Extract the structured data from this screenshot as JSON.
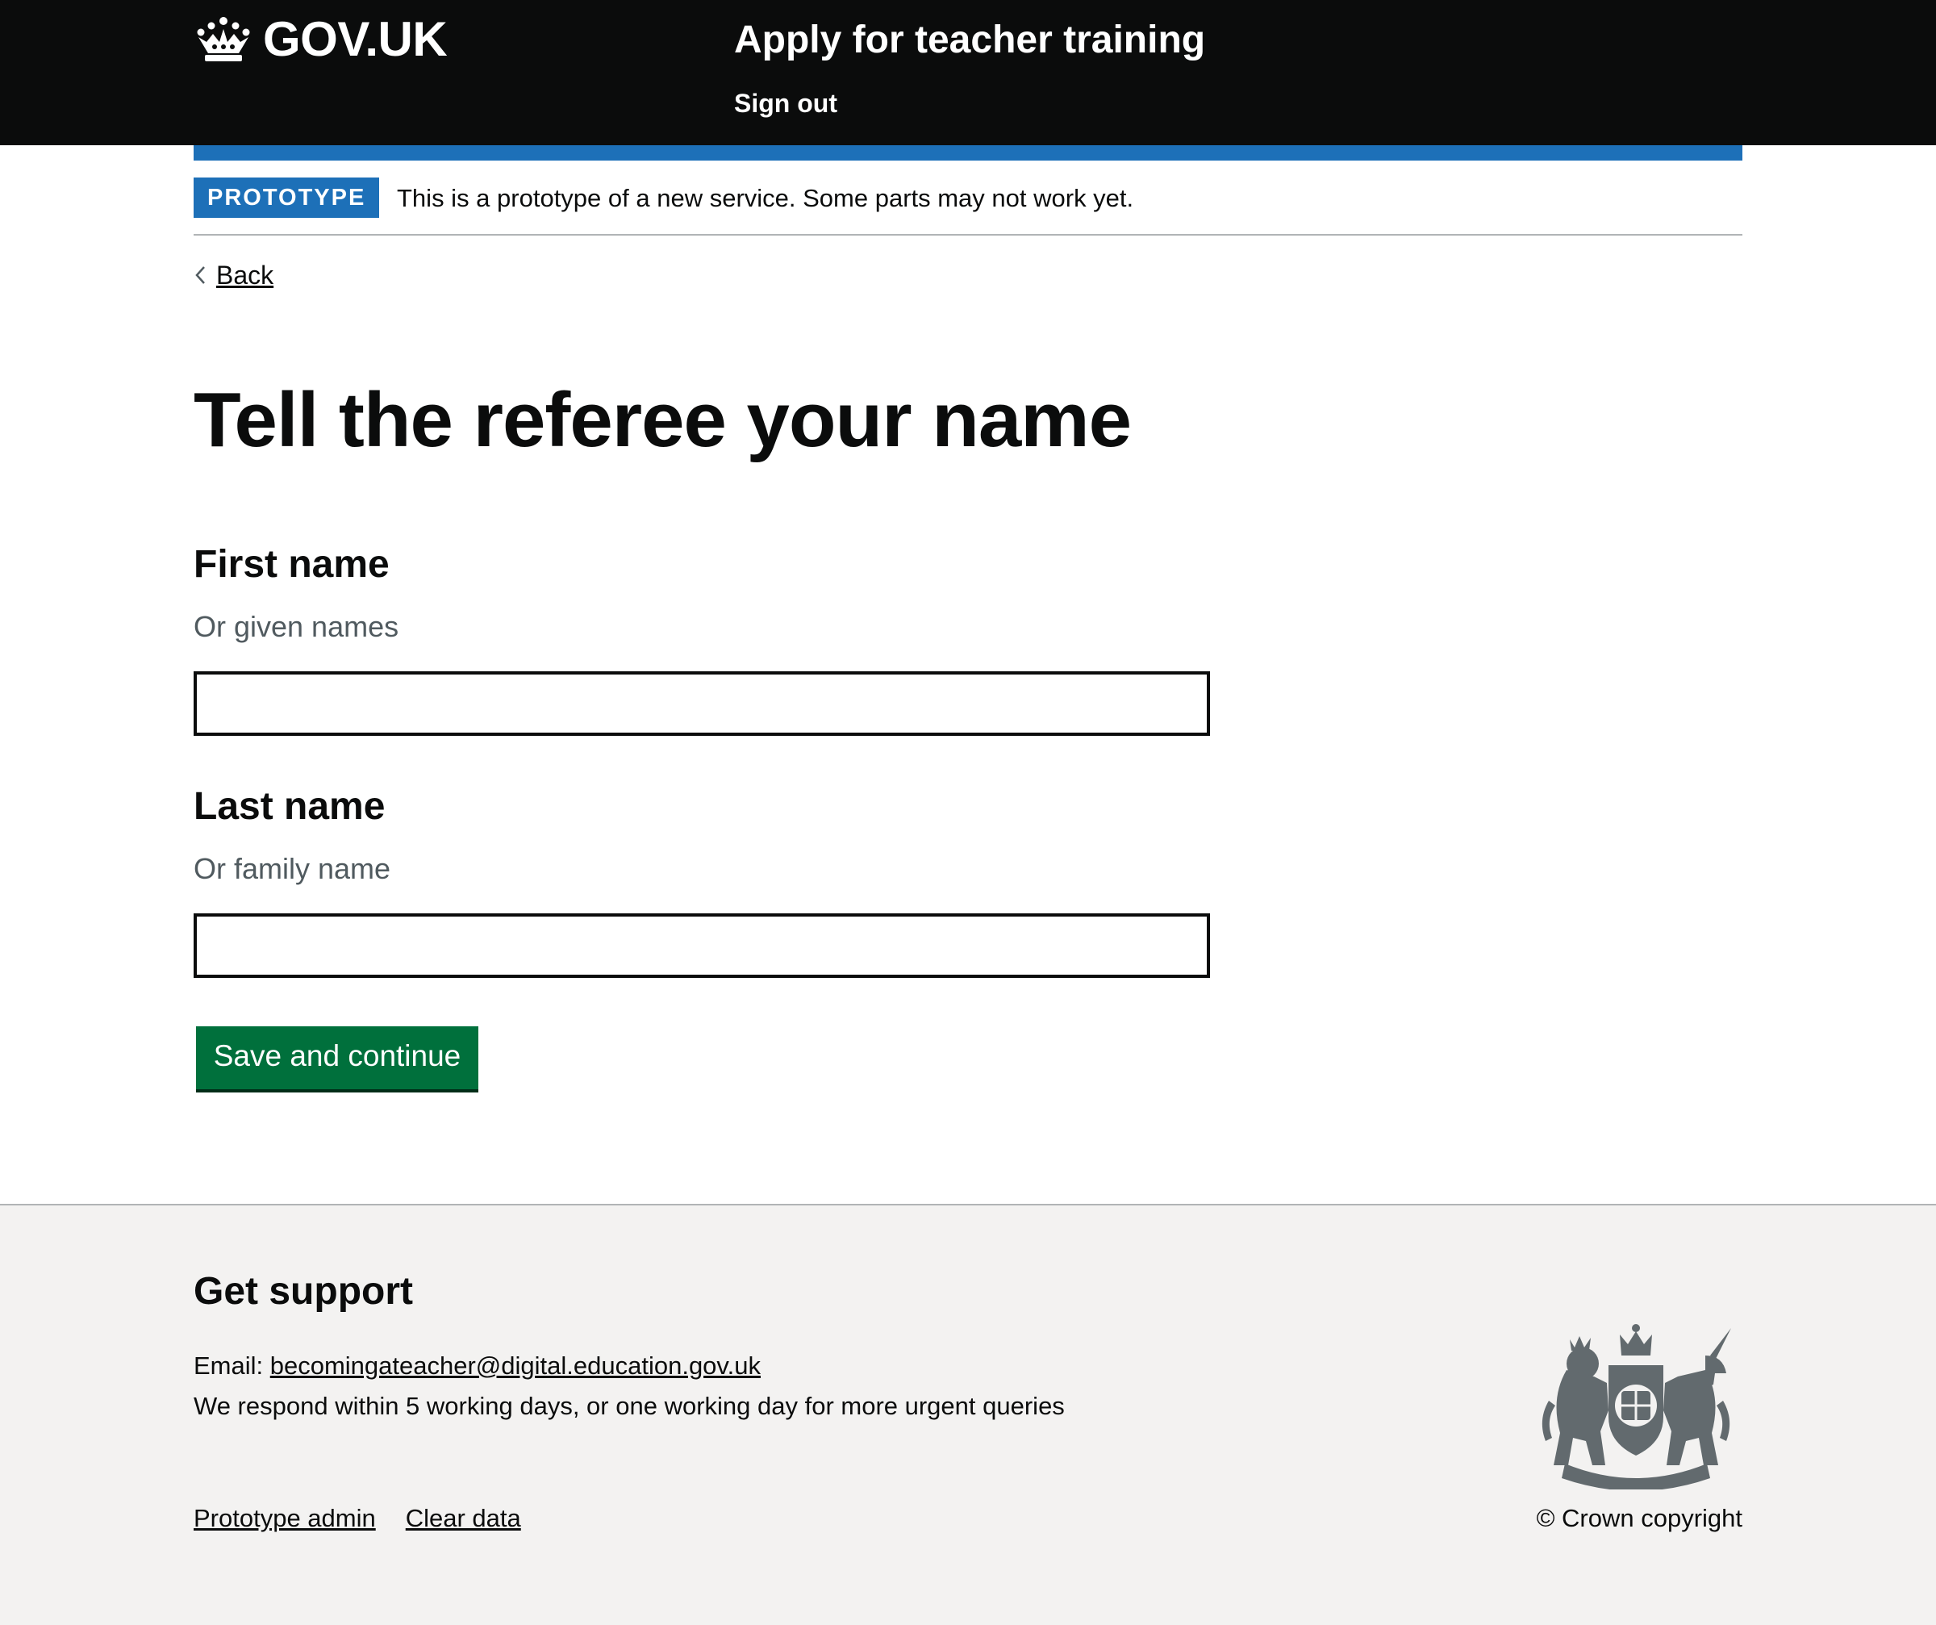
{
  "header": {
    "logo_text": "GOV.UK",
    "service_name": "Apply for teacher training",
    "sign_out": "Sign out",
    "logo_icon": "crown-icon"
  },
  "phase_banner": {
    "tag": "PROTOTYPE",
    "text": "This is a prototype of a new service. Some parts may not work yet."
  },
  "back_link": "Back",
  "page": {
    "title": "Tell the referee your name",
    "fields": [
      {
        "label": "First name",
        "hint": "Or given names",
        "value": ""
      },
      {
        "label": "Last name",
        "hint": "Or family name",
        "value": ""
      }
    ],
    "submit_label": "Save and continue"
  },
  "footer": {
    "support_title": "Get support",
    "email_prefix": "Email: ",
    "email": "becomingateacher@digital.education.gov.uk",
    "response_text": "We respond within 5 working days, or one working day for more urgent queries",
    "links": [
      "Prototype admin",
      "Clear data"
    ],
    "copyright": "© Crown copyright",
    "crest_icon": "royal-coat-of-arms-icon"
  },
  "colors": {
    "header_bg": "#0b0c0c",
    "brand_blue": "#1d70b8",
    "button_green": "#00703c",
    "footer_bg": "#f3f2f1",
    "hint_grey": "#505a5f"
  }
}
